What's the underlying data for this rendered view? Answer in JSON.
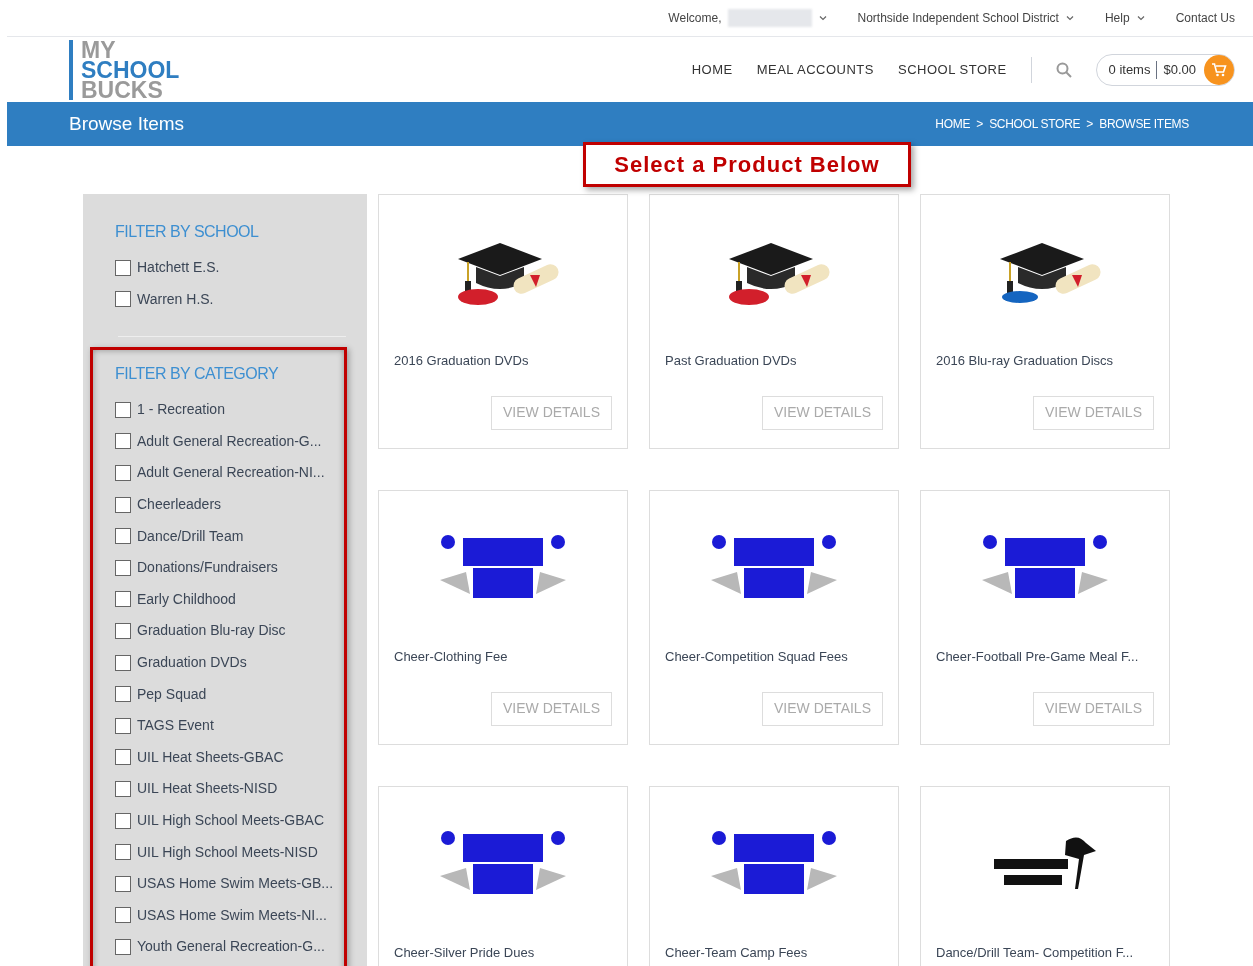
{
  "top_bar": {
    "welcome": "Welcome,",
    "district": "Northside Independent School District",
    "help": "Help",
    "contact": "Contact Us"
  },
  "logo": {
    "lines": [
      "MY",
      "SCHOOL",
      "BUCKS"
    ]
  },
  "nav": {
    "items": [
      "HOME",
      "MEAL ACCOUNTS",
      "SCHOOL STORE"
    ],
    "cart_items": "0 items",
    "cart_total": "$0.00"
  },
  "page_header": {
    "title": "Browse Items",
    "breadcrumb": [
      "HOME",
      "SCHOOL STORE",
      "BROWSE ITEMS"
    ],
    "separator": ">"
  },
  "callout": "Select a Product Below",
  "filters": [
    {
      "title": "FILTER BY SCHOOL",
      "highlighted": false,
      "options": [
        {
          "label": "Hatchett E.S.",
          "checked": false
        },
        {
          "label": "Warren H.S.",
          "checked": false
        }
      ]
    },
    {
      "title": "FILTER BY CATEGORY",
      "highlighted": true,
      "options": [
        {
          "label": "1 - Recreation",
          "checked": false
        },
        {
          "label": "Adult General Recreation-G...",
          "checked": false
        },
        {
          "label": "Adult General Recreation-NI...",
          "checked": false
        },
        {
          "label": "Cheerleaders",
          "checked": false
        },
        {
          "label": "Dance/Drill Team",
          "checked": false
        },
        {
          "label": "Donations/Fundraisers",
          "checked": false
        },
        {
          "label": "Early Childhood",
          "checked": false
        },
        {
          "label": "Graduation Blu-ray Disc",
          "checked": false
        },
        {
          "label": "Graduation DVDs",
          "checked": false
        },
        {
          "label": "Pep Squad",
          "checked": false
        },
        {
          "label": "TAGS Event",
          "checked": false
        },
        {
          "label": "UIL Heat Sheets-GBAC",
          "checked": false
        },
        {
          "label": "UIL Heat Sheets-NISD",
          "checked": false
        },
        {
          "label": "UIL High School Meets-GBAC",
          "checked": false
        },
        {
          "label": "UIL High School Meets-NISD",
          "checked": false
        },
        {
          "label": "USAS Home Swim Meets-GB...",
          "checked": false
        },
        {
          "label": "USAS Home Swim Meets-NI...",
          "checked": false
        },
        {
          "label": "Youth General Recreation-G...",
          "checked": false
        }
      ]
    }
  ],
  "products": [
    {
      "name": "2016 Graduation DVDs",
      "kind": "dvd",
      "button": "VIEW DETAILS"
    },
    {
      "name": "Past Graduation DVDs",
      "kind": "dvd",
      "button": "VIEW DETAILS"
    },
    {
      "name": "2016 Blu-ray Graduation Discs",
      "kind": "bluray",
      "button": "VIEW DETAILS"
    },
    {
      "name": "Cheer-Clothing Fee",
      "kind": "cheer",
      "button": "VIEW DETAILS"
    },
    {
      "name": "Cheer-Competition Squad Fees",
      "kind": "cheer",
      "button": "VIEW DETAILS"
    },
    {
      "name": "Cheer-Football Pre-Game Meal F...",
      "kind": "cheer",
      "button": "VIEW DETAILS"
    },
    {
      "name": "Cheer-Silver Pride Dues",
      "kind": "cheer"
    },
    {
      "name": "Cheer-Team Camp Fees",
      "kind": "cheer"
    },
    {
      "name": "Dance/Drill Team- Competition F...",
      "kind": "dance"
    }
  ]
}
